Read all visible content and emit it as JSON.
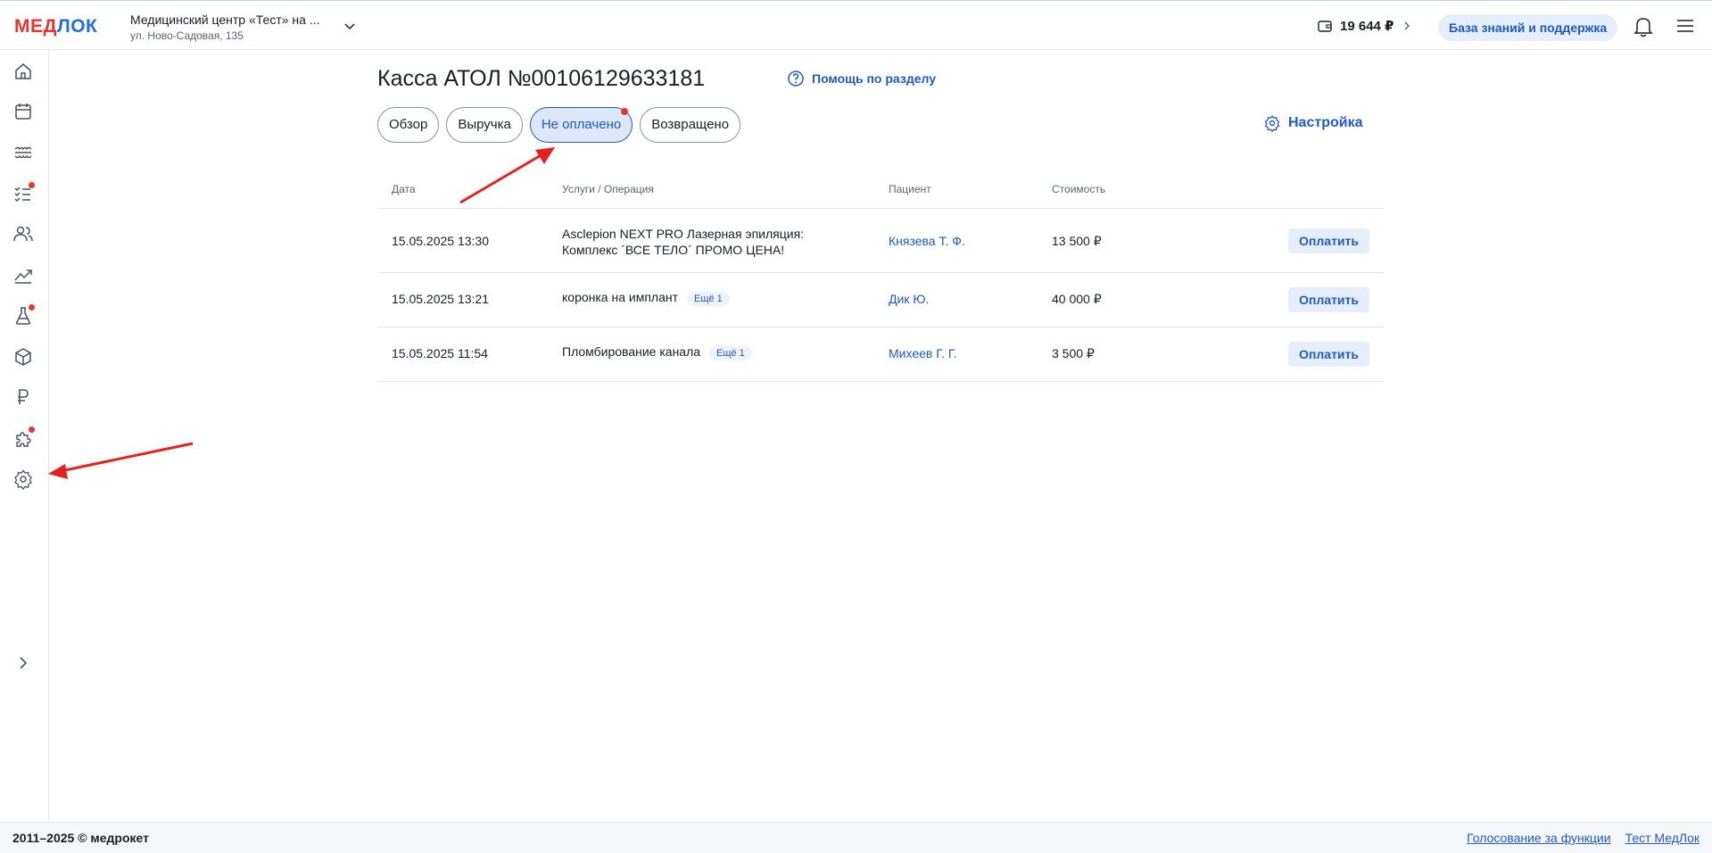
{
  "header": {
    "logo": {
      "part1": "МЕД",
      "part2": "ЛОК"
    },
    "clinic_name": "Медицинский центр «Тест» на ...",
    "clinic_address": "ул. Ново-Садовая, 135",
    "balance": "19 644 ₽",
    "support_label": "База знаний и поддержка"
  },
  "page": {
    "title": "Касса АТОЛ №00106129633181",
    "help_label": "Помощь по разделу",
    "settings_label": "Настройка",
    "tabs": [
      {
        "label": "Обзор"
      },
      {
        "label": "Выручка"
      },
      {
        "label": "Не оплачено"
      },
      {
        "label": "Возвращено"
      }
    ]
  },
  "table": {
    "headers": {
      "date": "Дата",
      "service": "Услуги / Операция",
      "patient": "Пациент",
      "cost": "Стоимость"
    },
    "rows": [
      {
        "date": "15.05.2025 13:30",
        "service": "Asclepion NEXT PRO Лазерная эпиляция: Комплекс ´ВСЕ ТЕЛО´ ПРОМО ЦЕНА!",
        "more": "",
        "patient": "Князева Т. Ф.",
        "cost": "13 500 ₽",
        "action": "Оплатить"
      },
      {
        "date": "15.05.2025 13:21",
        "service": "коронка на имплант",
        "more": "Ещё 1",
        "patient": "Дик Ю.",
        "cost": "40 000 ₽",
        "action": "Оплатить"
      },
      {
        "date": "15.05.2025 11:54",
        "service": "Пломбирование канала",
        "more": "Ещё 1",
        "patient": "Михеев Г. Г.",
        "cost": "3 500 ₽",
        "action": "Оплатить"
      }
    ]
  },
  "footer": {
    "copyright": "2011–2025 © медрокет",
    "links": [
      "Голосование за функции",
      "Тест МедЛок"
    ]
  },
  "colors": {
    "accent": "#1e5bc6",
    "brand_red": "#e9342e"
  }
}
